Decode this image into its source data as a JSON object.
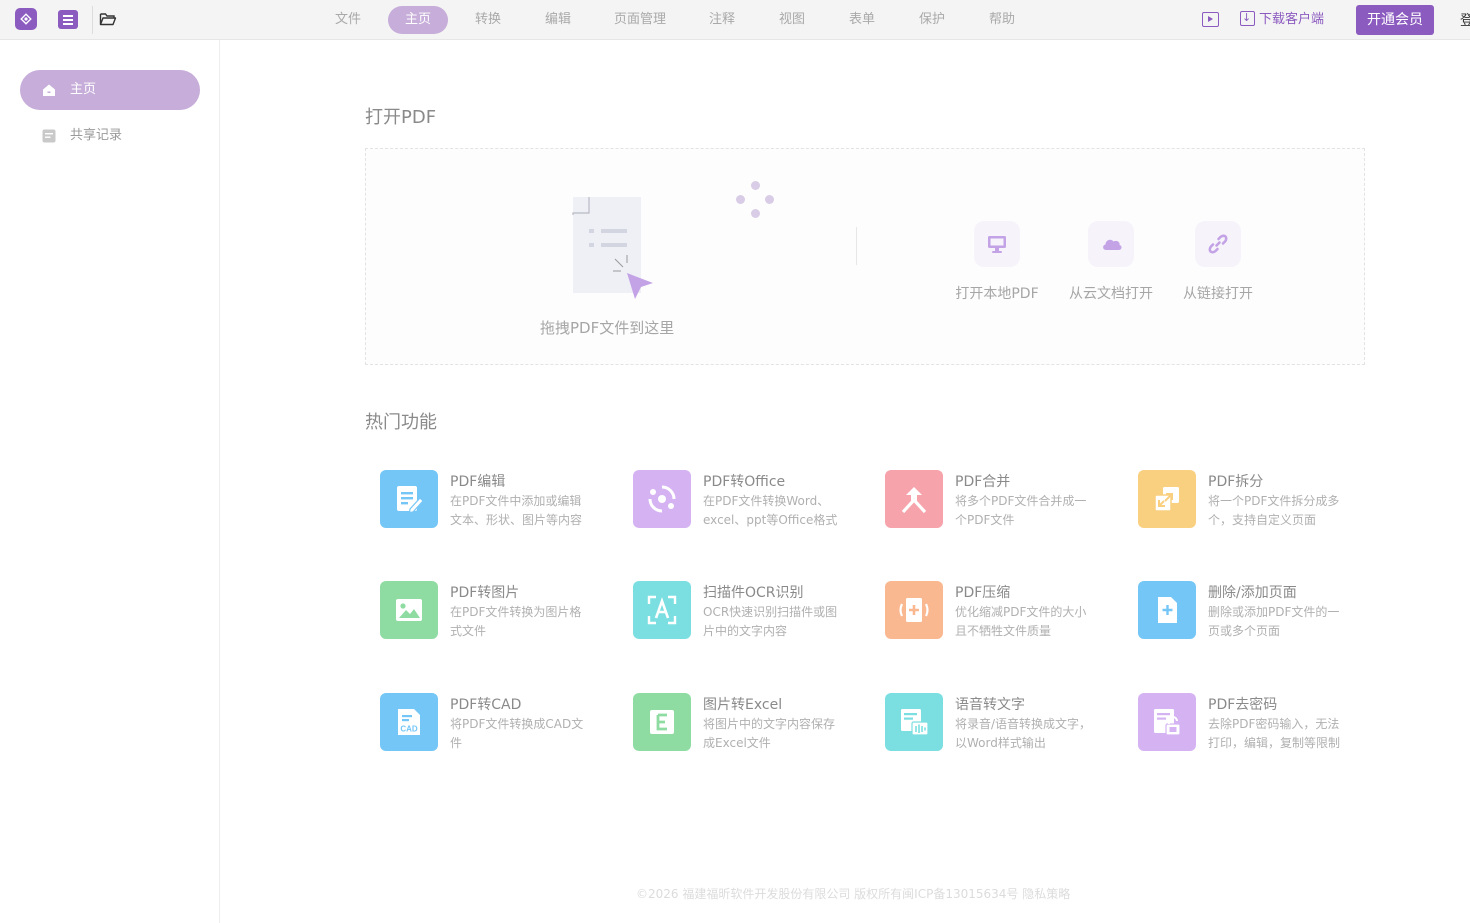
{
  "toolbar": {
    "logo_icon": "app-logo-icon",
    "menu_icon": "hamburger-menu-icon",
    "folder_icon": "open-folder-icon"
  },
  "nav": {
    "tabs": [
      {
        "label": "文件"
      },
      {
        "label": "主页"
      },
      {
        "label": "转换"
      },
      {
        "label": "编辑"
      },
      {
        "label": "页面管理"
      },
      {
        "label": "注释"
      },
      {
        "label": "视图"
      },
      {
        "label": "表单"
      },
      {
        "label": "保护"
      },
      {
        "label": "帮助"
      }
    ],
    "active": "主页"
  },
  "header_right": {
    "download_label": "下载客户端",
    "vip_label": "开通会员",
    "login_label": "登"
  },
  "sidebar": {
    "items": [
      {
        "label": "主页",
        "icon": "home-icon"
      },
      {
        "label": "共享记录",
        "icon": "document-icon"
      }
    ]
  },
  "open_pdf": {
    "title": "打开PDF",
    "drop_label": "拖拽PDF文件到这里",
    "options": [
      {
        "label": "打开本地PDF",
        "icon": "monitor-icon"
      },
      {
        "label": "从云文档打开",
        "icon": "cloud-icon"
      },
      {
        "label": "从链接打开",
        "icon": "link-icon"
      }
    ]
  },
  "hot_features": {
    "title": "热门功能",
    "items": [
      {
        "title": "PDF编辑",
        "desc": "在PDF文件中添加或编辑文本、形状、图片等内容",
        "icon": "edit-icon",
        "color": "#4fb4f5"
      },
      {
        "title": "PDF转Office",
        "desc": "在PDF文件转换Word、excel、ppt等Office格式",
        "icon": "convert-icon",
        "color": "#c79af0"
      },
      {
        "title": "PDF合并",
        "desc": "将多个PDF文件合并成一个PDF文件",
        "icon": "merge-icon",
        "color": "#f58a95"
      },
      {
        "title": "PDF拆分",
        "desc": "将一个PDF文件拆分成多个，支持自定义页面",
        "icon": "split-icon",
        "color": "#f8c465"
      },
      {
        "title": "PDF转图片",
        "desc": "在PDF文件转换为图片格式文件",
        "icon": "image-icon",
        "color": "#6fd28a"
      },
      {
        "title": "扫描件OCR识别",
        "desc": "OCR快速识别扫描件或图片中的文字内容",
        "icon": "ocr-icon",
        "color": "#4fd4d6"
      },
      {
        "title": "PDF压缩",
        "desc": "优化缩减PDF文件的大小且不牺牲文件质量",
        "icon": "compress-icon",
        "color": "#f8a070"
      },
      {
        "title": "删除/添加页面",
        "desc": "删除或添加PDF文件的一页或多个页面",
        "icon": "add-page-icon",
        "color": "#4fb4f5"
      },
      {
        "title": "PDF转CAD",
        "desc": "将PDF文件转换成CAD文件",
        "icon": "cad-icon",
        "color": "#4fb4f5"
      },
      {
        "title": "图片转Excel",
        "desc": "将图片中的文字内容保存成Excel文件",
        "icon": "excel-icon",
        "color": "#6fd28a"
      },
      {
        "title": "语音转文字",
        "desc": "将录音/语音转换成文字，以Word样式输出",
        "icon": "voice-icon",
        "color": "#4fd4d6"
      },
      {
        "title": "PDF去密码",
        "desc": "去除PDF密码输入，无法打印，编辑，复制等限制",
        "icon": "unlock-icon",
        "color": "#c79af0"
      }
    ]
  },
  "footer": {
    "text": "©2026 福建福昕软件开发股份有限公司 版权所有闽ICP备13015634号 隐私策略"
  }
}
